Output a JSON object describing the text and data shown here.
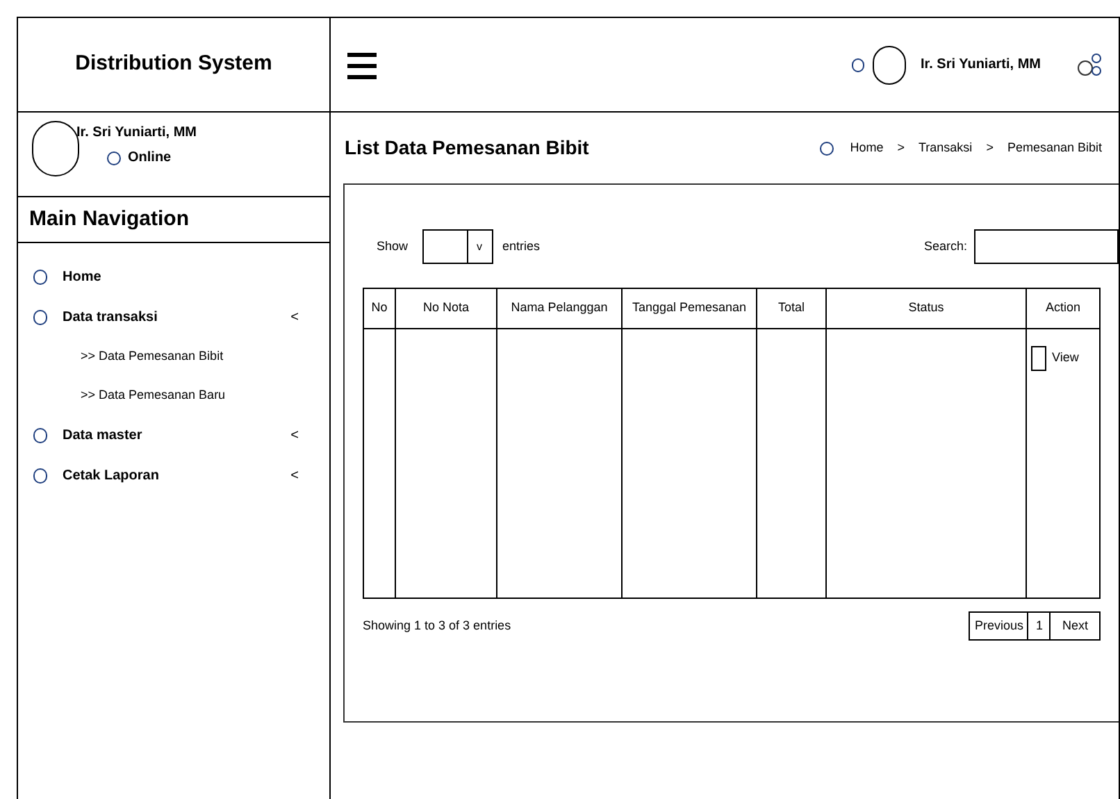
{
  "brand": "Distribution System",
  "header": {
    "user_name": "Ir. Sri Yuniarti, MM"
  },
  "sidebar": {
    "user": {
      "name": "Ir. Sri Yuniarti, MM",
      "status": "Online"
    },
    "nav_title": "Main Navigation",
    "items": [
      {
        "label": "Home",
        "expandable": false
      },
      {
        "label": "Data transaksi",
        "expandable": true,
        "children": [
          {
            "label": ">> Data Pemesanan Bibit"
          },
          {
            "label": ">> Data Pemesanan Baru"
          }
        ]
      },
      {
        "label": "Data master",
        "expandable": true
      },
      {
        "label": "Cetak Laporan",
        "expandable": true
      }
    ],
    "expand_glyph": "<"
  },
  "page_title": "List Data Pemesanan Bibit",
  "breadcrumb": [
    {
      "label": "Home"
    },
    {
      "label": "Transaksi"
    },
    {
      "label": "Pemesanan Bibit"
    }
  ],
  "breadcrumb_separator": ">",
  "table_controls": {
    "show_label": "Show",
    "dropdown_glyph": "v",
    "entries_label": "entries",
    "search_label": "Search:"
  },
  "table": {
    "columns": [
      "No",
      "No Nota",
      "Nama Pelanggan",
      "Tanggal Pemesanan",
      "Total",
      "Status",
      "Action"
    ],
    "action_label": "View"
  },
  "footer_info": "Showing 1 to 3 of 3 entries",
  "pagination": {
    "previous": "Previous",
    "page": "1",
    "next": "Next"
  }
}
